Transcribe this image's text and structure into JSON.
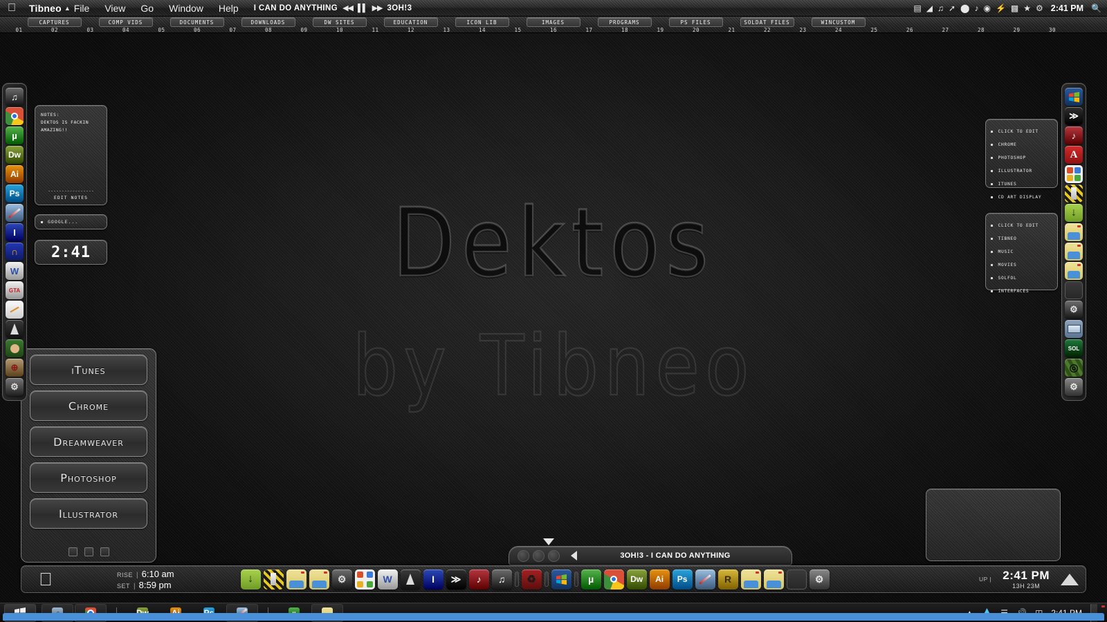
{
  "menubar": {
    "apple_icon": "apple-logo",
    "owner": "Tibneo",
    "triangle": "▲",
    "items": [
      "File",
      "View",
      "Go",
      "Window",
      "Help"
    ],
    "now_playing": {
      "title": "I CAN DO ANYTHING",
      "artist": "3OH!3",
      "prev": "◀◀",
      "pause": "▌▌",
      "next": "▶▶"
    },
    "tray_icons": [
      "bed-icon",
      "battery-icon",
      "music-note-icon",
      "pencil-icon",
      "shield-icon",
      "music-icon",
      "chrome-icon",
      "bolt-icon",
      "trash-icon",
      "star-icon",
      "gear-icon"
    ],
    "clock": "2:41 PM",
    "search_icon": "search-icon"
  },
  "tabstrip": {
    "numbers": [
      "01",
      "02",
      "03",
      "04",
      "05",
      "06",
      "07",
      "08",
      "09",
      "10",
      "11",
      "12",
      "13",
      "14",
      "15",
      "16",
      "17",
      "18",
      "19",
      "20",
      "21",
      "22",
      "23",
      "24",
      "25",
      "26",
      "27",
      "28",
      "29",
      "30"
    ],
    "chips": [
      {
        "slot": 1,
        "label": "CAPTURES"
      },
      {
        "slot": 3,
        "label": "COMP VIDS"
      },
      {
        "slot": 5,
        "label": "DOCUMENTS"
      },
      {
        "slot": 7,
        "label": "DOWNLOADS"
      },
      {
        "slot": 9,
        "label": "DW SITES"
      },
      {
        "slot": 11,
        "label": "EDUCATION"
      },
      {
        "slot": 13,
        "label": "ICON LIB"
      },
      {
        "slot": 15,
        "label": "IMAGES"
      },
      {
        "slot": 17,
        "label": "PROGRAMS"
      },
      {
        "slot": 19,
        "label": "PS FILES"
      },
      {
        "slot": 21,
        "label": "SOLDAT FILES"
      },
      {
        "slot": 23,
        "label": "WINCUSTOM"
      }
    ]
  },
  "wallpaper": {
    "title": "Dektos",
    "subtitle": "by Tibneo"
  },
  "notes": {
    "heading": "NOTES:",
    "body": "DEKTOS IS FACKIN AMAZING!!",
    "divider": "-----------------",
    "edit_label": "EDIT NOTES"
  },
  "google": {
    "placeholder": "GOOGLE..."
  },
  "clock_widget": {
    "time": "2:41"
  },
  "right_lists": [
    {
      "items": [
        "CLICK TO EDIT",
        "CHROME",
        "PHOTOSHOP",
        "ILLUSTRATOR",
        "ITUNES",
        "CD ART DISPLAY"
      ]
    },
    {
      "items": [
        "CLICK TO EDIT",
        "TIBNEO",
        "MUSIC",
        "MOVIES",
        "SOLFOL",
        "INTERFACES"
      ]
    }
  ],
  "launcher": {
    "buttons": [
      "iTunes",
      "Chrome",
      "Dreamweaver",
      "Photoshop",
      "Illustrator"
    ],
    "pager_count": 3
  },
  "left_dock": [
    {
      "name": "itunes-icon",
      "glyph": "♫",
      "bg": "#6d6d6d",
      "fg": "#ffffff"
    },
    {
      "name": "chrome-icon",
      "glyph": "",
      "bg": "#d94f38",
      "fg": "#ffffff"
    },
    {
      "name": "utorrent-icon",
      "glyph": "µ",
      "bg": "#55b34b",
      "fg": "#ffffff"
    },
    {
      "name": "dreamweaver-icon",
      "glyph": "Dw",
      "bg": "#8aa33c",
      "fg": "#ffffff"
    },
    {
      "name": "illustrator-icon",
      "glyph": "Ai",
      "bg": "#e8930f",
      "fg": "#ffffff"
    },
    {
      "name": "photoshop-icon",
      "glyph": "Ps",
      "bg": "#2aa4dd",
      "fg": "#ffffff"
    },
    {
      "name": "photo-editor-icon",
      "glyph": "",
      "bg": "#7d8fa0",
      "fg": "#ffffff"
    },
    {
      "name": "irfanview-icon",
      "glyph": "I",
      "bg": "#2c49b8",
      "fg": "#ffffff"
    },
    {
      "name": "headphones-icon",
      "glyph": "∩",
      "bg": "#1b2f9c",
      "fg": "#f5a623"
    },
    {
      "name": "word-icon",
      "glyph": "W",
      "bg": "#f2f2f2",
      "fg": "#2b4ea8"
    },
    {
      "name": "gta-icon",
      "glyph": "GTA",
      "bg": "#f0f0f0",
      "fg": "#c81b1b"
    },
    {
      "name": "paint-icon",
      "glyph": "",
      "bg": "#e9e9e9",
      "fg": "#333333"
    },
    {
      "name": "cone-icon",
      "glyph": "▲",
      "bg": "#2b2b2b",
      "fg": "#3b6bd6"
    },
    {
      "name": "game-avatar-icon",
      "glyph": "",
      "bg": "#3d7a2e",
      "fg": "#ffffff"
    },
    {
      "name": "crosshair-icon",
      "glyph": "⊕",
      "bg": "#b49a73",
      "fg": "#8a1616"
    },
    {
      "name": "settings-gear-icon",
      "glyph": "⚙",
      "bg": "#777777",
      "fg": "#dddddd"
    }
  ],
  "right_dock": [
    {
      "name": "windows-icon",
      "glyph": "",
      "bg": "#1b3e78",
      "fg": "#ffffff"
    },
    {
      "name": "media-player-icon",
      "glyph": "≫",
      "bg": "#2f2f2f",
      "fg": "#ffffff"
    },
    {
      "name": "music-clef-icon",
      "glyph": "♪",
      "bg": "#b5373f",
      "fg": "#ffffff"
    },
    {
      "name": "pdf-icon",
      "glyph": "",
      "bg": "#c01a1a",
      "fg": "#ffffff"
    },
    {
      "name": "office-icon",
      "glyph": "",
      "bg": "#e4e4e4",
      "fg": "#333333"
    },
    {
      "name": "hazard-icon",
      "glyph": "",
      "bg": "#e5c318",
      "fg": "#1a1a1a"
    },
    {
      "name": "downloads-icon",
      "glyph": "↓",
      "bg": "#8fbd3c",
      "fg": "#1b2b06"
    },
    {
      "name": "folder-icon",
      "glyph": "",
      "bg": "#ddd07a",
      "fg": "#3a73b5"
    },
    {
      "name": "folder-icon",
      "glyph": "",
      "bg": "#ddd07a",
      "fg": "#3a73b5"
    },
    {
      "name": "folder-icon",
      "glyph": "",
      "bg": "#ddd07a",
      "fg": "#3a73b5"
    },
    {
      "name": "empty-slot-icon",
      "glyph": "",
      "bg": "#343434",
      "fg": "#343434"
    },
    {
      "name": "gear-icon",
      "glyph": "⚙",
      "bg": "#6f6f6f",
      "fg": "#e0e0e0"
    },
    {
      "name": "display-icon",
      "glyph": "▭",
      "bg": "#c9d4e4",
      "fg": "#3b5c8c"
    },
    {
      "name": "soldat-icon",
      "glyph": "SOL",
      "bg": "#1f7a3c",
      "fg": "#ffffff"
    },
    {
      "name": "camo-target-icon",
      "glyph": "⊕",
      "bg": "#4c7a2a",
      "fg": "#111111"
    },
    {
      "name": "gear-icon",
      "glyph": "⚙",
      "bg": "#8a8a8a",
      "fg": "#e8e8e8"
    }
  ],
  "media_bar": {
    "track": "3OH!3 -  I CAN DO ANYTHING",
    "bubble_count": 3,
    "play_icon": "play-triangle-icon"
  },
  "dock": {
    "apple_icon": "apple-logo",
    "sun": {
      "rise_label": "RISE",
      "rise_time": "6:10 am",
      "set_label": "SET",
      "set_time": "8:59 pm",
      "separator": "|"
    },
    "icons": [
      {
        "name": "downloads-icon",
        "glyph": "↓",
        "bg": "#8fbd3c",
        "fg": "#1b2b06"
      },
      {
        "name": "hazard-icon",
        "glyph": "",
        "bg": "#e5c318",
        "fg": "#1a1a1a"
      },
      {
        "name": "folder-icon",
        "glyph": "",
        "bg": "#ddd07a",
        "fg": "#3a73b5"
      },
      {
        "name": "folder-icon",
        "glyph": "",
        "bg": "#ddd07a",
        "fg": "#3a73b5"
      },
      {
        "name": "gear-icon",
        "glyph": "⚙",
        "bg": "#6f6f6f",
        "fg": "#e0e0e0"
      },
      {
        "name": "office-icon",
        "glyph": "",
        "bg": "#e4e4e4",
        "fg": "#333333"
      },
      {
        "name": "word-icon",
        "glyph": "W",
        "bg": "#f2f2f2",
        "fg": "#2b4ea8"
      },
      {
        "name": "cone-icon",
        "glyph": "▲",
        "bg": "#2b2b2b",
        "fg": "#3b6bd6"
      },
      {
        "name": "irfanview-icon",
        "glyph": "I",
        "bg": "#2c49b8",
        "fg": "#ffffff"
      },
      {
        "name": "media-player-icon",
        "glyph": "≫",
        "bg": "#2f2f2f",
        "fg": "#ffffff"
      },
      {
        "name": "music-clef-icon",
        "glyph": "♪",
        "bg": "#b5373f",
        "fg": "#ffffff"
      },
      {
        "name": "itunes-icon",
        "glyph": "♫",
        "bg": "#6d6d6d",
        "fg": "#ffffff"
      },
      {
        "name": "separator",
        "glyph": "",
        "bg": "",
        "fg": ""
      },
      {
        "name": "recycle-bin-icon",
        "glyph": "♻",
        "bg": "#8c1f1f",
        "fg": "#1a1a1a"
      },
      {
        "name": "separator",
        "glyph": "",
        "bg": "",
        "fg": ""
      },
      {
        "name": "windows-icon",
        "glyph": "",
        "bg": "#1b3e78",
        "fg": "#ffffff"
      },
      {
        "name": "separator",
        "glyph": "",
        "bg": "",
        "fg": ""
      },
      {
        "name": "utorrent-icon",
        "glyph": "µ",
        "bg": "#55b34b",
        "fg": "#ffffff"
      },
      {
        "name": "chrome-icon",
        "glyph": "",
        "bg": "#d94f38",
        "fg": "#ffffff"
      },
      {
        "name": "dreamweaver-icon",
        "glyph": "Dw",
        "bg": "#8aa33c",
        "fg": "#ffffff"
      },
      {
        "name": "illustrator-icon",
        "glyph": "Ai",
        "bg": "#e8930f",
        "fg": "#ffffff"
      },
      {
        "name": "photoshop-icon",
        "glyph": "Ps",
        "bg": "#2aa4dd",
        "fg": "#ffffff"
      },
      {
        "name": "photo-editor-icon",
        "glyph": "",
        "bg": "#7d8fa0",
        "fg": "#ffffff"
      },
      {
        "name": "rainmeter-icon",
        "glyph": "R",
        "bg": "#d8b93a",
        "fg": "#3a2d00"
      },
      {
        "name": "folder-icon",
        "glyph": "",
        "bg": "#ddd07a",
        "fg": "#3a73b5"
      },
      {
        "name": "folder-icon",
        "glyph": "",
        "bg": "#ddd07a",
        "fg": "#3a73b5"
      },
      {
        "name": "empty-slot-icon",
        "glyph": "",
        "bg": "#333333",
        "fg": "#333333"
      },
      {
        "name": "gear-icon",
        "glyph": "⚙",
        "bg": "#8a8a8a",
        "fg": "#e8e8e8"
      }
    ],
    "uptime_label": "UP |",
    "clock": "2:41 PM",
    "uptime": "13H 23M"
  },
  "taskbar": {
    "start_icon": "windows-start-icon",
    "buttons": [
      {
        "name": "taskbar-itunes",
        "glyph": "♫",
        "bg": "#9fb7cf",
        "fg": "#1c3a55",
        "active": true
      },
      {
        "name": "taskbar-chrome",
        "glyph": "",
        "bg": "#d94f38",
        "fg": "#ffffff",
        "active": true
      },
      {
        "name": "taskbar-divider",
        "glyph": "",
        "bg": "",
        "fg": "",
        "active": false
      },
      {
        "name": "taskbar-dreamweaver",
        "glyph": "Dw",
        "bg": "#8aa33c",
        "fg": "#ffffff",
        "active": false
      },
      {
        "name": "taskbar-illustrator",
        "glyph": "Ai",
        "bg": "#e8930f",
        "fg": "#ffffff",
        "active": false
      },
      {
        "name": "taskbar-photoshop",
        "glyph": "Ps",
        "bg": "#2aa4dd",
        "fg": "#ffffff",
        "active": false
      },
      {
        "name": "taskbar-photo-editor",
        "glyph": "",
        "bg": "#5d7ea8",
        "fg": "#ffffff",
        "active": true
      },
      {
        "name": "taskbar-divider",
        "glyph": "",
        "bg": "",
        "fg": "",
        "active": false
      },
      {
        "name": "taskbar-utorrent",
        "glyph": "µ",
        "bg": "#55b34b",
        "fg": "#ffffff",
        "active": false
      },
      {
        "name": "taskbar-folder",
        "glyph": "",
        "bg": "#ddd07a",
        "fg": "#3a73b5",
        "active": true
      }
    ],
    "tray_icons": [
      "show-hidden-icon",
      "droplet-icon",
      "signal-bars-icon",
      "volume-icon",
      "device-icon"
    ],
    "clock": "2:41 PM"
  }
}
